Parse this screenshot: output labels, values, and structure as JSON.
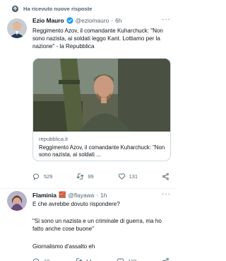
{
  "context": {
    "label": "Ha ricevuto nuove risposte"
  },
  "tweets": [
    {
      "author": "Ezio Mauro",
      "handle": "@eziomauro",
      "separator": "·",
      "time": "6h",
      "text": "Reggimento Azov, il comandante Kuharchuck: \"Non sono nazista, ai soldati leggo Kant. Lottiamo per la nazione\" - la Repubblica",
      "card": {
        "domain": "repubblica.it",
        "title": "Reggimento Azov, il comandante Kuharchuck: \"Non sono nazista, ai soldati ..."
      },
      "actions": {
        "replies": "529",
        "retweets": "99",
        "likes": "131"
      }
    },
    {
      "author": "Flaminia",
      "author_emoji": "🧱",
      "handle": "@flayawa",
      "separator": "·",
      "time": "1h",
      "text_lines": [
        "E che avrebbe dovuto rispondere?",
        "\"Si sono un nazista e un criminale di guerra, ma ho fatto anche cose buone\"",
        "Giornalismo d'assalto eh"
      ],
      "actions": {
        "replies": "10",
        "retweets": "14",
        "likes": "132"
      }
    }
  ],
  "colors": {
    "accent": "#1d9bf0",
    "secondary_text": "#536471",
    "divider": "#eff3f4"
  }
}
